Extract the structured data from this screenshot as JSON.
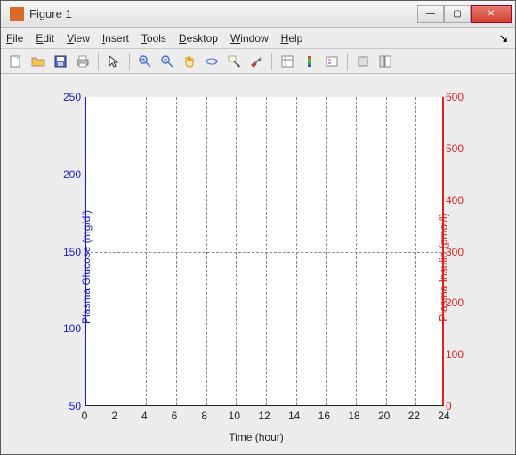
{
  "window": {
    "title": "Figure 1"
  },
  "menu": {
    "file": "File",
    "edit": "Edit",
    "view": "View",
    "insert": "Insert",
    "tools": "Tools",
    "desktop": "Desktop",
    "window": "Window",
    "help": "Help"
  },
  "chart_data": {
    "type": "line",
    "title": "",
    "xlabel": "Time (hour)",
    "ylabel_left": "Plasma Glucose (mg/dl)",
    "ylabel_right": "Plasma Insulin (pmol/l)",
    "xlim": [
      0,
      24
    ],
    "ylim_left": [
      50,
      250
    ],
    "ylim_right": [
      0,
      600
    ],
    "xticks": [
      0,
      2,
      4,
      6,
      8,
      10,
      12,
      14,
      16,
      18,
      20,
      22,
      24
    ],
    "yticks_left": [
      50,
      100,
      150,
      200,
      250
    ],
    "yticks_right": [
      0,
      100,
      200,
      300,
      400,
      500,
      600
    ],
    "series": []
  }
}
